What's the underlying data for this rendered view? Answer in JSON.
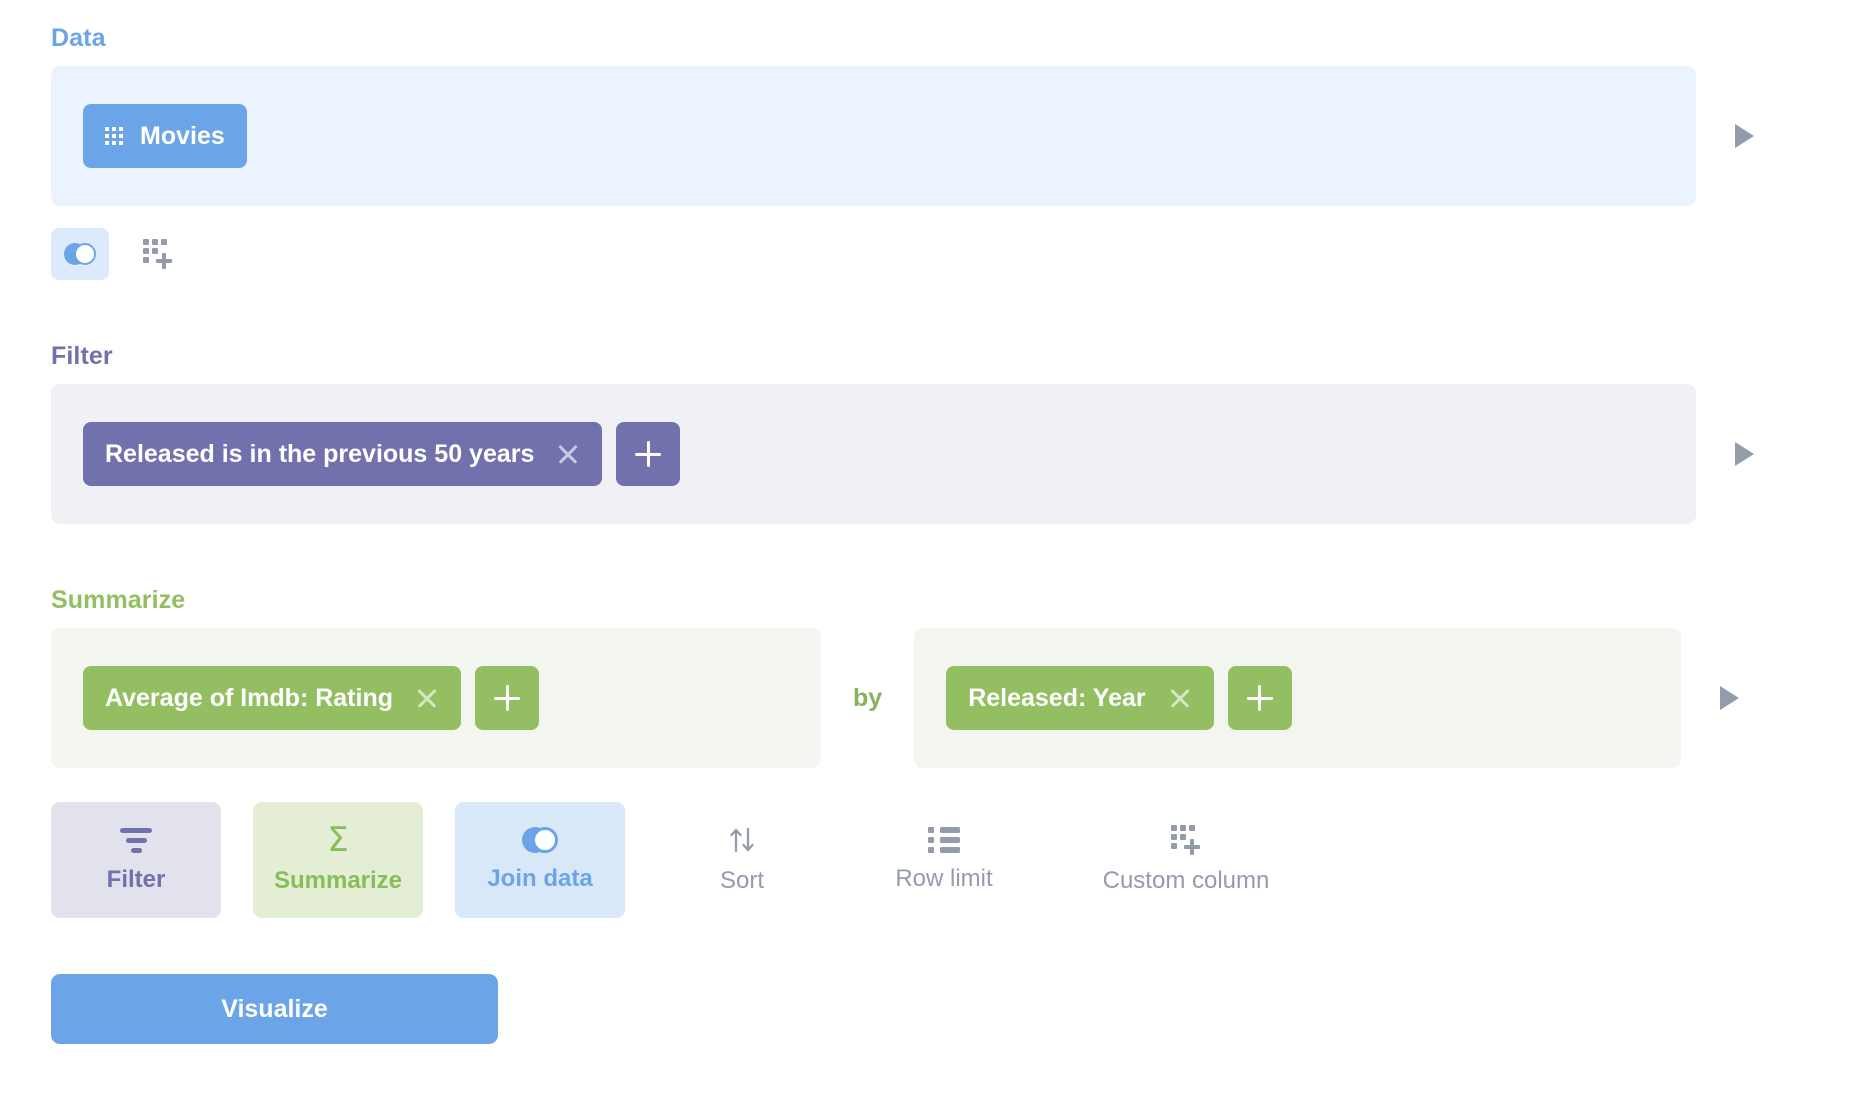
{
  "sections": {
    "data": {
      "label": "Data",
      "source_pill": {
        "name": "Movies",
        "icon": "table-grid-icon"
      },
      "expand_icon": "play-arrow-icon",
      "mini_buttons": [
        {
          "name": "join-data",
          "icon": "venn-diagram-icon",
          "active": true
        },
        {
          "name": "custom-column",
          "icon": "custom-column-icon",
          "active": false
        }
      ]
    },
    "filter": {
      "label": "Filter",
      "pills": [
        {
          "text": "Released is in the previous 50 years",
          "remove_icon": "close-icon"
        }
      ],
      "add_label": "+",
      "expand_icon": "play-arrow-icon"
    },
    "summarize": {
      "label": "Summarize",
      "aggregations": [
        {
          "text": "Average of Imdb: Rating",
          "remove_icon": "close-icon"
        }
      ],
      "by_label": "by",
      "breakouts": [
        {
          "text": "Released: Year",
          "remove_icon": "close-icon"
        }
      ],
      "add_label": "+",
      "expand_icon": "play-arrow-icon"
    }
  },
  "action_buttons": [
    {
      "label": "Filter",
      "icon": "funnel-icon",
      "style": "filter"
    },
    {
      "label": "Summarize",
      "icon": "sigma-icon",
      "style": "summarize"
    },
    {
      "label": "Join data",
      "icon": "venn-diagram-icon",
      "style": "join"
    },
    {
      "label": "Sort",
      "icon": "sort-arrows-icon",
      "style": "plain"
    },
    {
      "label": "Row limit",
      "icon": "list-icon",
      "style": "plain"
    },
    {
      "label": "Custom column",
      "icon": "custom-column-icon",
      "style": "plain"
    }
  ],
  "footer": {
    "visualize_label": "Visualize"
  },
  "colors": {
    "data_accent": "#6BA5E7",
    "filter_accent": "#7172AD",
    "summarize_accent": "#93BE62",
    "muted": "#949BAB",
    "data_bg": "#EBF3FE",
    "filter_bg": "#F0F0F5",
    "summarize_bg": "#F3F6EE"
  }
}
